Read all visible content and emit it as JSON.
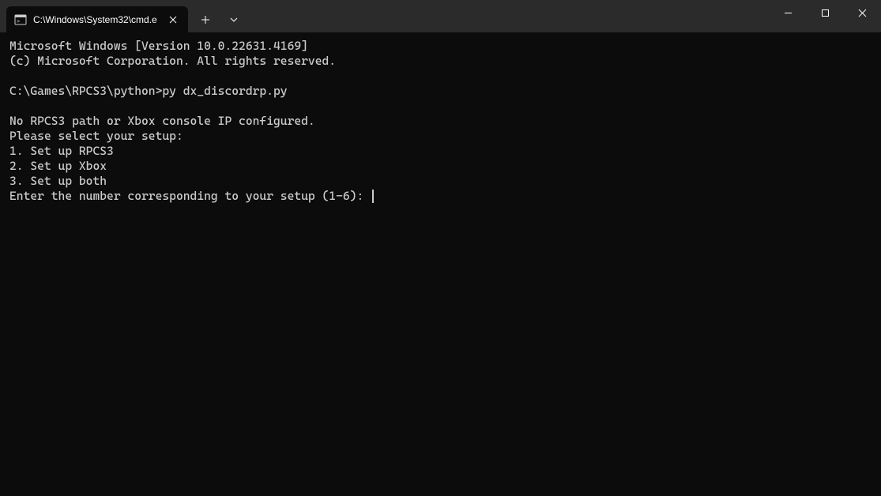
{
  "tab": {
    "title": "C:\\Windows\\System32\\cmd.e"
  },
  "terminal": {
    "line1": "Microsoft Windows [Version 10.0.22631.4169]",
    "line2": "(c) Microsoft Corporation. All rights reserved.",
    "blank1": "",
    "prompt_line": "C:\\Games\\RPCS3\\python>py dx_discordrp.py",
    "blank2": "",
    "out1": "No RPCS3 path or Xbox console IP configured.",
    "out2": "Please select your setup:",
    "out3": "1. Set up RPCS3",
    "out4": "2. Set up Xbox",
    "out5": "3. Set up both",
    "out6": "Enter the number corresponding to your setup (1-6): "
  }
}
